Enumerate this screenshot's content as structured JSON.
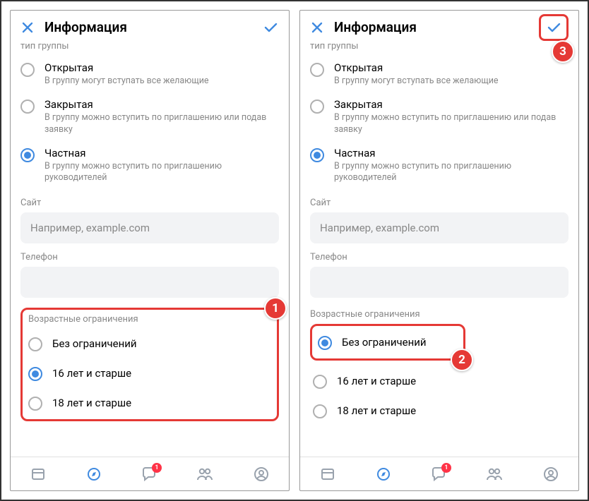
{
  "header": {
    "title": "Информация"
  },
  "groupTypeLabel": "тип группы",
  "groupTypes": [
    {
      "title": "Открытая",
      "desc": "В группу могут вступать все желающие"
    },
    {
      "title": "Закрытая",
      "desc": "В группу можно вступить по приглашению или подав заявку"
    },
    {
      "title": "Частная",
      "desc": "В группу можно вступить по приглашению руководителей"
    }
  ],
  "site": {
    "label": "Сайт",
    "placeholder": "Например, example.com"
  },
  "phone": {
    "label": "Телефон"
  },
  "ageLabel": "Возрастные ограничения",
  "ageOptions": [
    "Без ограничений",
    "16 лет и старше",
    "18 лет и старше"
  ],
  "nav": {
    "badge": "1"
  },
  "steps": {
    "one": "1",
    "two": "2",
    "three": "3"
  }
}
